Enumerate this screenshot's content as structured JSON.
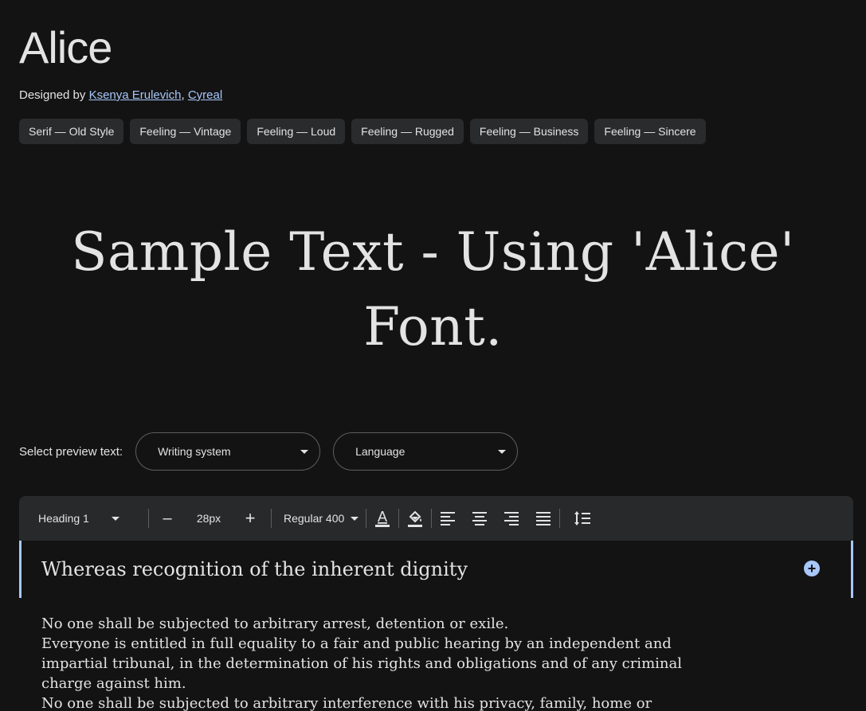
{
  "font": {
    "title": "Alice",
    "designed_by_label": "Designed by",
    "designers": [
      "Ksenya Erulevich",
      "Cyreal"
    ],
    "designer_separator": ","
  },
  "tags": [
    "Serif — Old Style",
    "Feeling — Vintage",
    "Feeling — Loud",
    "Feeling — Rugged",
    "Feeling — Business",
    "Feeling — Sincere"
  ],
  "sample_text": "Sample Text - Using 'Alice' Font.",
  "preview": {
    "label": "Select preview text:",
    "writing_system": "Writing system",
    "language": "Language"
  },
  "toolbar": {
    "style": "Heading 1",
    "decrease": "–",
    "size": "28px",
    "increase": "+",
    "weight": "Regular 400",
    "icons": [
      "text-color-icon",
      "highlight-color-icon",
      "align-left-icon",
      "align-center-icon",
      "align-right-icon",
      "align-justify-icon",
      "line-height-icon"
    ]
  },
  "editor": {
    "heading": "Whereas recognition of the inherent dignity",
    "paragraph_lines": [
      "No one shall be subjected to arbitrary arrest, detention or exile.",
      "Everyone is entitled in full equality to a fair and public hearing by an independent and",
      "impartial tribunal, in the determination of his rights and obligations and of any criminal",
      "charge against him.",
      "No one shall be subjected to arbitrary interference with his privacy, family, home or"
    ]
  },
  "colors": {
    "background": "#131314",
    "chip": "#2a2b2d",
    "toolbar": "#28292a",
    "accent": "#a8c7fa",
    "text": "#e3e3e3"
  }
}
